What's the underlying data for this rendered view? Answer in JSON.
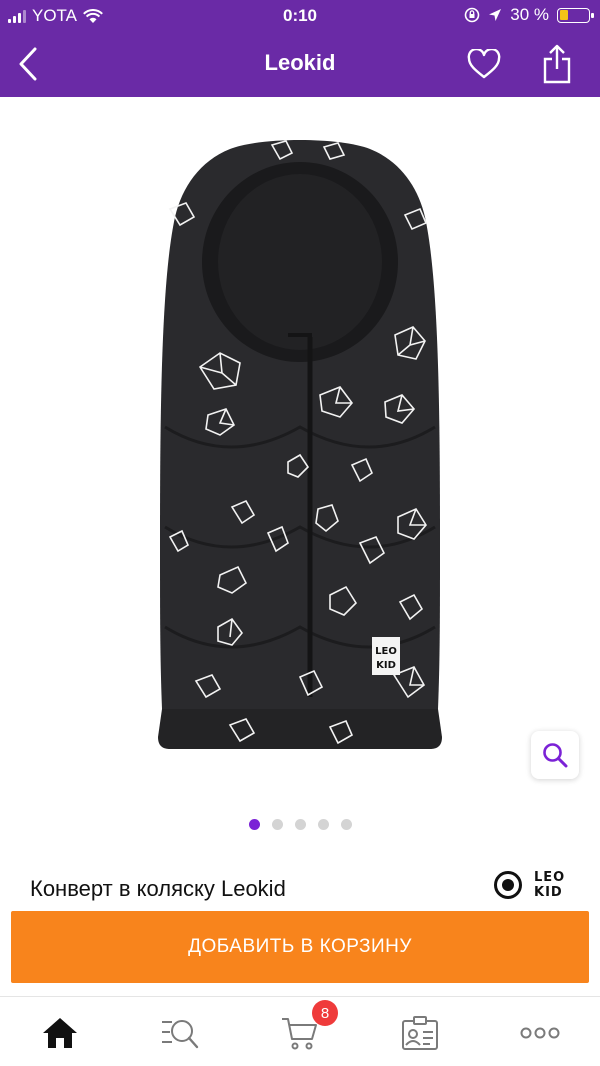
{
  "status_bar": {
    "carrier": "YOTA",
    "time": "0:10",
    "battery_percent": "30 %",
    "battery_level": 0.3,
    "battery_color": "#f5c518"
  },
  "header": {
    "title": "Leokid",
    "back_icon": "chevron-left-icon",
    "favorite_icon": "heart-icon",
    "share_icon": "share-icon",
    "background_color": "#6a2aa6"
  },
  "gallery": {
    "image_count": 5,
    "active_index": 0,
    "zoom_icon": "magnifier-icon",
    "product_label": "LEO KID"
  },
  "product": {
    "title": "Конверт в коляску Leokid",
    "brand_mark": "LEO KID"
  },
  "actions": {
    "add_to_cart_label": "ДОБАВИТЬ В КОРЗИНУ",
    "accent_color": "#f8841c"
  },
  "tabbar": {
    "items": [
      {
        "name": "home",
        "icon": "home-icon",
        "active": true
      },
      {
        "name": "search",
        "icon": "search-icon",
        "active": false
      },
      {
        "name": "cart",
        "icon": "cart-icon",
        "active": false
      },
      {
        "name": "profile",
        "icon": "profile-card-icon",
        "active": false
      },
      {
        "name": "more",
        "icon": "more-icon",
        "active": false
      }
    ],
    "cart_badge": "8"
  }
}
